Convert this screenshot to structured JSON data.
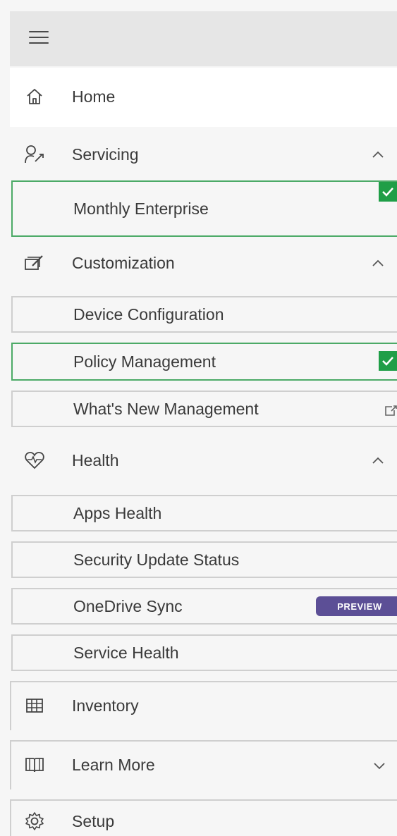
{
  "nav": {
    "home": {
      "label": "Home",
      "icon": "home-icon"
    },
    "servicing": {
      "label": "Servicing",
      "icon": "servicing-icon",
      "expanded": true,
      "items": [
        {
          "label": "Monthly Enterprise",
          "selected": true
        }
      ]
    },
    "customization": {
      "label": "Customization",
      "icon": "customization-icon",
      "expanded": true,
      "items": [
        {
          "label": "Device Configuration",
          "selected": false
        },
        {
          "label": "Policy Management",
          "selected": true
        },
        {
          "label": "What's New Management",
          "selected": false,
          "external": true
        }
      ]
    },
    "health": {
      "label": "Health",
      "icon": "heart-icon",
      "expanded": true,
      "items": [
        {
          "label": "Apps Health"
        },
        {
          "label": "Security Update Status"
        },
        {
          "label": "OneDrive Sync",
          "badge": "PREVIEW"
        },
        {
          "label": "Service Health"
        }
      ]
    },
    "inventory": {
      "label": "Inventory",
      "icon": "grid-icon"
    },
    "learn_more": {
      "label": "Learn More",
      "icon": "book-icon",
      "expanded": false
    },
    "setup": {
      "label": "Setup",
      "icon": "gear-icon"
    }
  },
  "colors": {
    "selected_border": "#4caa67",
    "check_fill": "#1f9e47",
    "badge_fill": "#5c4f96"
  }
}
